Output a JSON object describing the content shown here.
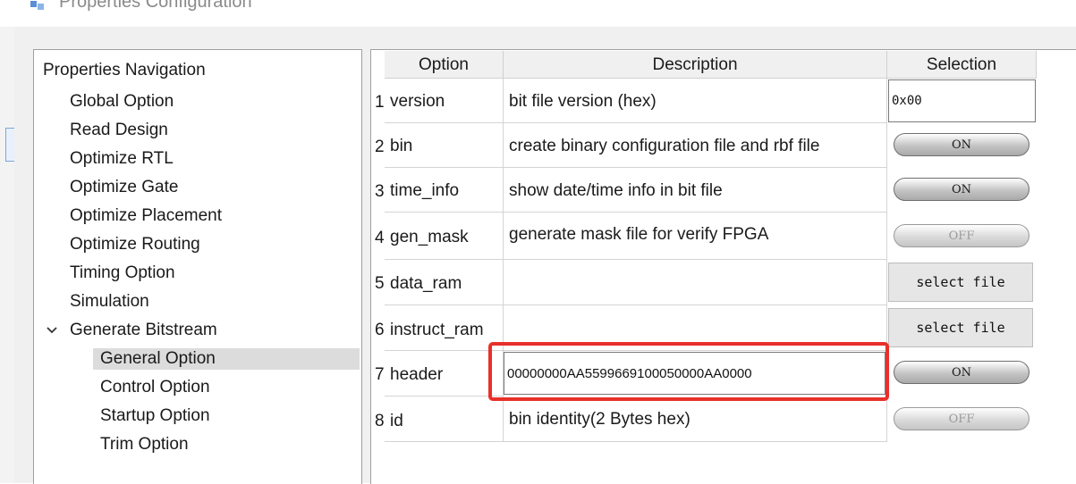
{
  "window": {
    "title": "Properties Configuration"
  },
  "navigation": {
    "title": "Properties Navigation",
    "items": [
      {
        "label": "Global Option"
      },
      {
        "label": "Read Design"
      },
      {
        "label": "Optimize RTL"
      },
      {
        "label": "Optimize Gate"
      },
      {
        "label": "Optimize Placement"
      },
      {
        "label": "Optimize Routing"
      },
      {
        "label": "Timing Option"
      },
      {
        "label": "Simulation"
      },
      {
        "label": "Generate Bitstream",
        "expanded": true
      },
      {
        "label": "General Option",
        "selected": true
      },
      {
        "label": "Control Option"
      },
      {
        "label": "Startup Option"
      },
      {
        "label": "Trim Option"
      }
    ]
  },
  "table": {
    "headers": {
      "option": "Option",
      "description": "Description",
      "selection": "Selection"
    },
    "rows": [
      {
        "num": "1",
        "option": "version",
        "description": "bit file version (hex)",
        "selection": "0x00",
        "selection_type": "input"
      },
      {
        "num": "2",
        "option": "bin",
        "description": "create binary configuration file and rbf file",
        "selection": "ON",
        "selection_type": "toggle-on"
      },
      {
        "num": "3",
        "option": "time_info",
        "description": "show date/time info in bit file",
        "selection": "ON",
        "selection_type": "toggle-on"
      },
      {
        "num": "4",
        "option": "gen_mask",
        "description": "generate mask file for verify FPGA",
        "selection": "OFF",
        "selection_type": "toggle-off"
      },
      {
        "num": "5",
        "option": "data_ram",
        "description": "",
        "selection": "select file",
        "selection_type": "button"
      },
      {
        "num": "6",
        "option": "instruct_ram",
        "description": "",
        "selection": "select file",
        "selection_type": "button"
      },
      {
        "num": "7",
        "option": "header",
        "description": "00000000AA5599669100050000AA0000",
        "selection": "ON",
        "selection_type": "toggle-on"
      },
      {
        "num": "8",
        "option": "id",
        "description": "bin identity(2 Bytes hex)",
        "selection": "OFF",
        "selection_type": "toggle-off"
      }
    ]
  },
  "colors": {
    "highlight": "#e8302a",
    "selected_row": "#dcdcdc",
    "panel_border": "#a0a0a0"
  }
}
